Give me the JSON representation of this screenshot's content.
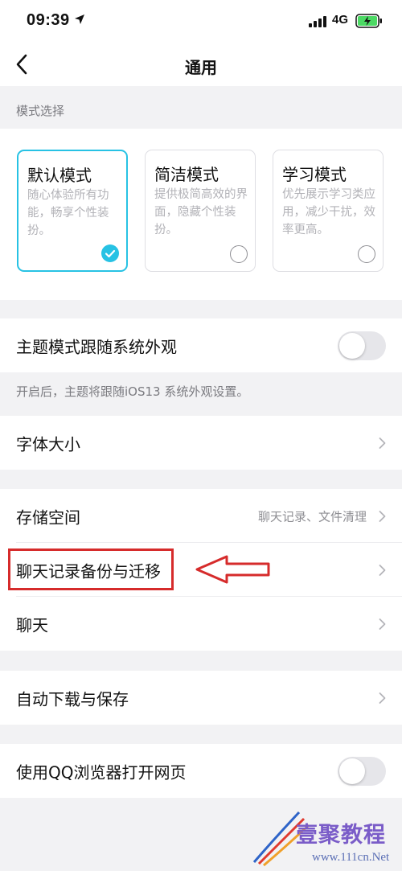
{
  "status_bar": {
    "time": "09:39",
    "network": "4G",
    "icons": [
      "location-arrow-icon",
      "signal-icon",
      "battery-charging-icon"
    ]
  },
  "nav": {
    "title": "通用",
    "back_icon": "chevron-left-icon"
  },
  "mode_section": {
    "caption": "模式选择",
    "modes": [
      {
        "title": "默认模式",
        "description": "随心体验所有功能，畅享个性装扮。",
        "selected": true
      },
      {
        "title": "简洁模式",
        "description": "提供极简高效的界面，隐藏个性装扮。",
        "selected": false
      },
      {
        "title": "学习模式",
        "description": "优先展示学习类应用，减少干扰，效率更高。",
        "selected": false
      }
    ]
  },
  "theme_follow": {
    "label": "主题模式跟随系统外观",
    "enabled": false,
    "note": "开启后，主题将跟随iOS13 系统外观设置。"
  },
  "font_size": {
    "label": "字体大小"
  },
  "storage_group": {
    "storage": {
      "label": "存储空间",
      "value": "聊天记录、文件清理"
    },
    "chat_backup": {
      "label": "聊天记录备份与迁移"
    },
    "chat": {
      "label": "聊天"
    }
  },
  "auto_download": {
    "label": "自动下载与保存"
  },
  "qq_browser": {
    "label": "使用QQ浏览器打开网页",
    "enabled": false
  },
  "annotation": {
    "color": "#d62b2b"
  },
  "watermark": {
    "text": "壹聚教程",
    "url": "www.111cn.Net"
  },
  "colors": {
    "accent": "#27c2e4",
    "background": "#f2f2f4",
    "annotation_red": "#d62b2b"
  }
}
